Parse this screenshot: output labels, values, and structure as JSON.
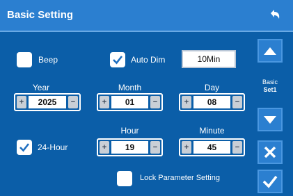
{
  "header": {
    "title": "Basic Setting",
    "back_icon": "back-arrow-icon"
  },
  "beep": {
    "label": "Beep",
    "checked": false
  },
  "auto_dim": {
    "label": "Auto Dim",
    "checked": true,
    "value": "10Min"
  },
  "date": {
    "year": {
      "label": "Year",
      "value": "2025"
    },
    "month": {
      "label": "Month",
      "value": "01"
    },
    "day": {
      "label": "Day",
      "value": "08"
    }
  },
  "time": {
    "format_label": "24-Hour",
    "format_checked": true,
    "hour": {
      "label": "Hour",
      "value": "19"
    },
    "minute": {
      "label": "Minute",
      "value": "45"
    }
  },
  "lock": {
    "label": "Lock Parameter Setting",
    "checked": false
  },
  "stepper_symbols": {
    "dec": "+",
    "inc": "−"
  },
  "side": {
    "page_line1": "Basic",
    "page_line2": "Set1",
    "up_icon": "triangle-up-icon",
    "down_icon": "triangle-down-icon",
    "cancel_icon": "x-icon",
    "confirm_icon": "checkmark-icon"
  },
  "colors": {
    "background": "#0b5ea8",
    "header": "#2b7fd0",
    "button": "#2b7fd0"
  }
}
